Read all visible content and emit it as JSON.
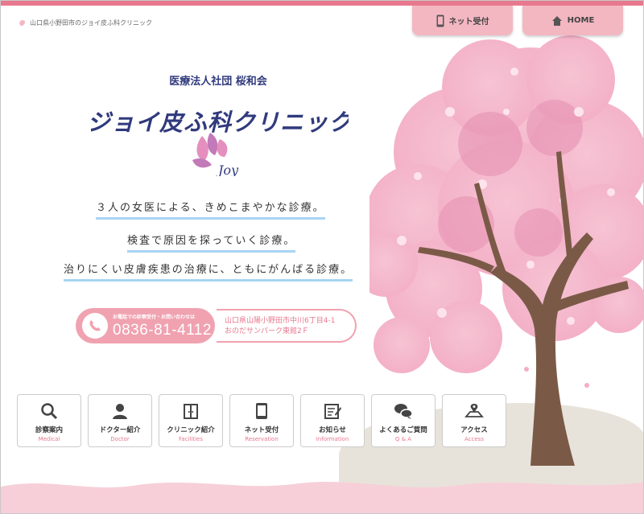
{
  "header": {
    "breadcrumb": "山口県小野田市のジョイ皮ふ科クリニック",
    "net_label": "ネット受付",
    "home_label": "HOME"
  },
  "clinic": {
    "org": "医療法人社団 桜和会",
    "name": "ジョイ皮ふ科クリニック",
    "mark_text": "Joy"
  },
  "taglines": [
    "３人の女医による、きめこまやかな診療。",
    "検査で原因を探っていく診療。",
    "治りにくい皮膚疾患の治療に、ともにがんばる診療。"
  ],
  "contact": {
    "note": "お電話での診察受付・お問い合わせは",
    "phone": "0836-81-4112",
    "address_line1": "山口県山陽小野田市中川6丁目4-1",
    "address_line2": "おのだサンパーク東館2Ｆ"
  },
  "nav": [
    {
      "jp": "診察案内",
      "en": "Medical",
      "icon": "search-icon"
    },
    {
      "jp": "ドクター紹介",
      "en": "Doctor",
      "icon": "person-icon"
    },
    {
      "jp": "クリニック紹介",
      "en": "Facilities",
      "icon": "door-icon"
    },
    {
      "jp": "ネット受付",
      "en": "Reservation",
      "icon": "smartphone-icon"
    },
    {
      "jp": "お知らせ",
      "en": "Information",
      "icon": "notebook-icon"
    },
    {
      "jp": "よくあるご質問",
      "en": "Q & A",
      "icon": "speech-bubble-icon"
    },
    {
      "jp": "アクセス",
      "en": "Access",
      "icon": "map-icon"
    }
  ],
  "colors": {
    "accent_pink": "#e8788e",
    "button_pink": "#f3b7c2",
    "navy": "#303a7d",
    "underline_blue": "#a8d4f3"
  }
}
